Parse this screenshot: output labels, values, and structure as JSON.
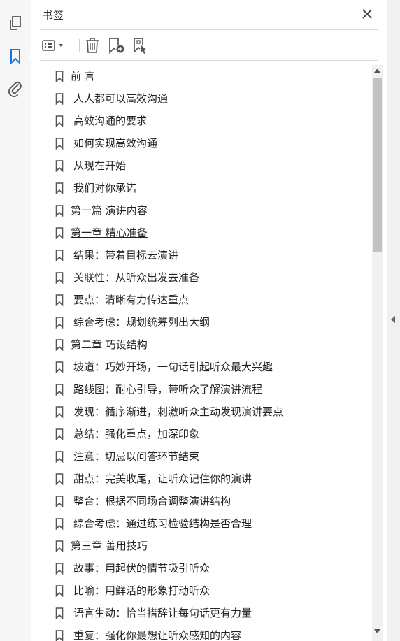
{
  "panel": {
    "title": "书签"
  },
  "icons": {
    "rail": [
      "pages-icon",
      "bookmark-icon",
      "attachment-icon"
    ],
    "toolbar": [
      "options-icon",
      "delete-icon",
      "new-bookmark-icon",
      "bookmark-from-structure-icon"
    ]
  },
  "colors": {
    "accent": "#1473e6",
    "icon": "#555555"
  },
  "bookmarks": [
    {
      "label": "前 言",
      "level": "sec"
    },
    {
      "label": "人人都可以高效沟通",
      "level": "sub"
    },
    {
      "label": "高效沟通的要求",
      "level": "sub"
    },
    {
      "label": "如何实现高效沟通",
      "level": "sub"
    },
    {
      "label": "从现在开始",
      "level": "sub"
    },
    {
      "label": "我们对你承诺",
      "level": "sub"
    },
    {
      "label": "第一篇 演讲内容",
      "level": "sec"
    },
    {
      "label": "第一章 精心准备",
      "level": "sec",
      "underlined": true
    },
    {
      "label": "结果：带着目标去演讲",
      "level": "sub"
    },
    {
      "label": "关联性：从听众出发去准备",
      "level": "sub"
    },
    {
      "label": "要点：清晰有力传达重点",
      "level": "sub"
    },
    {
      "label": "综合考虑：规划统筹列出大纲",
      "level": "sub"
    },
    {
      "label": "第二章 巧设结构",
      "level": "sec"
    },
    {
      "label": "坡道：巧妙开场，一句话引起听众最大兴趣",
      "level": "sub"
    },
    {
      "label": "路线图：耐心引导，带听众了解演讲流程",
      "level": "sub"
    },
    {
      "label": "发现：循序渐进，刺激听众主动发现演讲要点",
      "level": "sub"
    },
    {
      "label": "总结：强化重点，加深印象",
      "level": "sub"
    },
    {
      "label": "注意：切忌以问答环节结束",
      "level": "sub"
    },
    {
      "label": "甜点：完美收尾，让听众记住你的演讲",
      "level": "sub"
    },
    {
      "label": "整合：根据不同场合调整演讲结构",
      "level": "sub"
    },
    {
      "label": "综合考虑：通过练习检验结构是否合理",
      "level": "sub"
    },
    {
      "label": "第三章 善用技巧",
      "level": "sec"
    },
    {
      "label": "故事：用起伏的情节吸引听众",
      "level": "sub"
    },
    {
      "label": "比喻：用鲜活的形象打动听众",
      "level": "sub"
    },
    {
      "label": "语言生动：恰当措辞让每句话更有力量",
      "level": "sub"
    },
    {
      "label": "重复：强化你最想让听众感知的内容",
      "level": "sub"
    }
  ]
}
